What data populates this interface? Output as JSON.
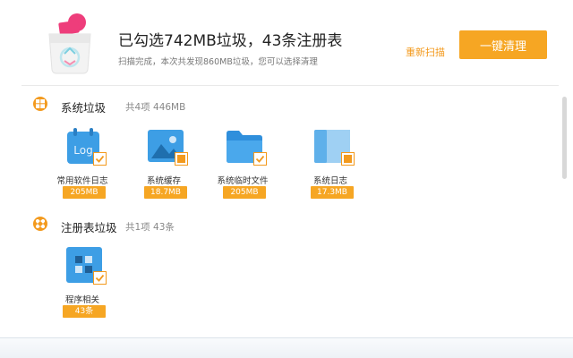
{
  "header": {
    "title": "已勾选742MB垃圾，43条注册表",
    "subtitle": "扫描完成，本次共发现860MB垃圾，您可以选择清理",
    "rescan_label": "重新扫描",
    "clean_label": "一键清理"
  },
  "sections": [
    {
      "title": "系统垃圾",
      "summary": "共4项 446MB",
      "items": [
        {
          "label": "常用软件日志",
          "size": "205MB",
          "icon": "log-calendar-icon",
          "checked": "full"
        },
        {
          "label": "系统缓存",
          "size": "18.7MB",
          "icon": "image-cache-icon",
          "checked": "partial"
        },
        {
          "label": "系统临时文件",
          "size": "205MB",
          "icon": "folder-icon",
          "checked": "full"
        },
        {
          "label": "系统日志",
          "size": "17.3MB",
          "icon": "book-icon",
          "checked": "partial"
        }
      ]
    },
    {
      "title": "注册表垃圾",
      "summary": "共1项 43条",
      "items": [
        {
          "label": "程序相关",
          "size": "43条",
          "icon": "app-grid-icon",
          "checked": "full"
        }
      ]
    }
  ],
  "colors": {
    "accent": "#f6a623",
    "icon_blue": "#3d9ee5"
  }
}
